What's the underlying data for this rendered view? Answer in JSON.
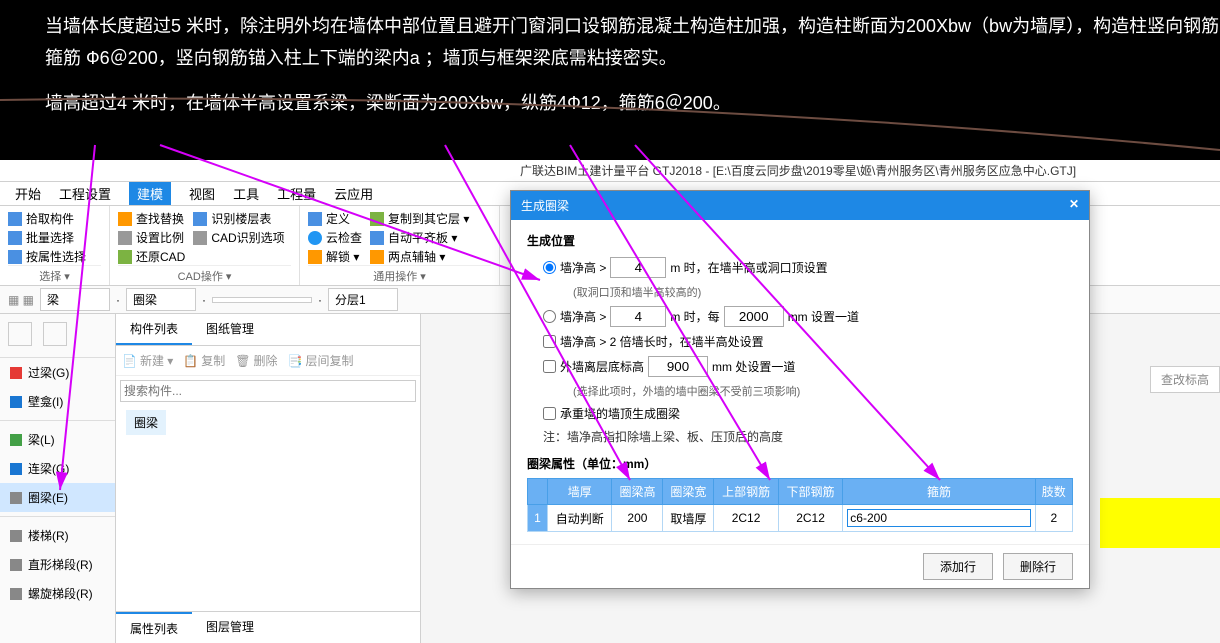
{
  "annotations": {
    "line1": "当墙体长度超过5 米时，除注明外均在墙体中部位置且避开门窗洞口设钢筋混凝土构造柱加强，构造柱断面为200Xbw（bw为墙厚），构造柱竖向钢筋",
    "line2": "箍筋  Ф6＠200，竖向钢筋锚入柱上下端的梁内a  ；墙顶与框架梁底需粘接密实。",
    "line3": "墙高超过4 米时，在墙体半高设置系梁，梁断面为200Xbw，纵筋4Ф12，箍筋6＠200。"
  },
  "title": "广联达BIM土建计量平台 GTJ2018 - [E:\\百度云同步盘\\2019零星\\姬\\青州服务区\\青州服务区应急中心.GTJ]",
  "menu": {
    "start": "开始",
    "proj": "工程设置",
    "model": "建模",
    "view": "视图",
    "tools": "工具",
    "quantity": "工程量",
    "cloud": "云应用",
    "search_placeholder": "查改标高"
  },
  "ribbon": {
    "g1": {
      "i1": "拾取构件",
      "i2": "批量选择",
      "i3": "按属性选择",
      "label": "选择 ▾"
    },
    "g2": {
      "i1": "查找替换",
      "i2": "设置比例",
      "i3": "还原CAD",
      "j1": "识别楼层表",
      "j2": "CAD识别选项",
      "label": "CAD操作 ▾"
    },
    "g3": {
      "i1": "定义",
      "i2": "云检查",
      "i3": "解锁 ▾",
      "j1": "复制到其它层 ▾",
      "j2": "自动平齐板 ▾",
      "j3": "两点辅轴 ▾",
      "label": "通用操作 ▾"
    }
  },
  "selectors": {
    "s1": "梁",
    "s2": "圈梁",
    "s3": "",
    "s4": "分层1"
  },
  "left": {
    "cats": [
      {
        "name": "过梁(G)",
        "ic": "ic-red"
      },
      {
        "name": "壁龛(I)",
        "ic": "ic-blue"
      },
      {
        "name": "梁(L)",
        "ic": "ic-green"
      },
      {
        "name": "连梁(G)",
        "ic": "ic-blue"
      },
      {
        "name": "圈梁(E)",
        "ic": "ic-gray",
        "sel": true
      },
      {
        "name": "楼梯(R)",
        "ic": "ic-gray"
      },
      {
        "name": "直形梯段(R)",
        "ic": "ic-gray"
      },
      {
        "name": "螺旋梯段(R)",
        "ic": "ic-gray"
      }
    ]
  },
  "mid": {
    "tab1": "构件列表",
    "tab2": "图纸管理",
    "new": "新建 ▾",
    "copy": "复制",
    "del": "删除",
    "layercopy": "层间复制",
    "search_ph": "搜索构件...",
    "item": "圈梁",
    "btab1": "属性列表",
    "btab2": "图层管理"
  },
  "dialog": {
    "title": "生成圈梁",
    "section": "生成位置",
    "opt1a": "墙净高 >",
    "opt1_val": "4",
    "opt1b": "m 时，在墙半高或洞口顶设置",
    "opt1_sub": "(取洞口顶和墙半高较高的)",
    "opt2a": "墙净高 >",
    "opt2_val": "4",
    "opt2b": "m 时，每",
    "opt2_val2": "2000",
    "opt2c": "mm 设置一道",
    "opt3": "墙净高 > 2 倍墙长时，在墙半高处设置",
    "opt4a": "外墙离层底标高",
    "opt4_val": "900",
    "opt4b": "mm 处设置一道",
    "opt4_sub": "(选择此项时，外墙的墙中圈梁不受前三项影响)",
    "opt5": "承重墙的墙顶生成圈梁",
    "note": "注：墙净高指扣除墙上梁、板、压顶后的高度",
    "prop_label": "圈梁属性（单位：mm）",
    "headers": [
      "墙厚",
      "圈梁高",
      "圈梁宽",
      "上部钢筋",
      "下部钢筋",
      "箍筋",
      "肢数"
    ],
    "row": [
      "自动判断",
      "200",
      "取墙厚",
      "2C12",
      "2C12",
      "c6-200",
      "2"
    ],
    "addrow": "添加行",
    "delrow": "删除行"
  }
}
